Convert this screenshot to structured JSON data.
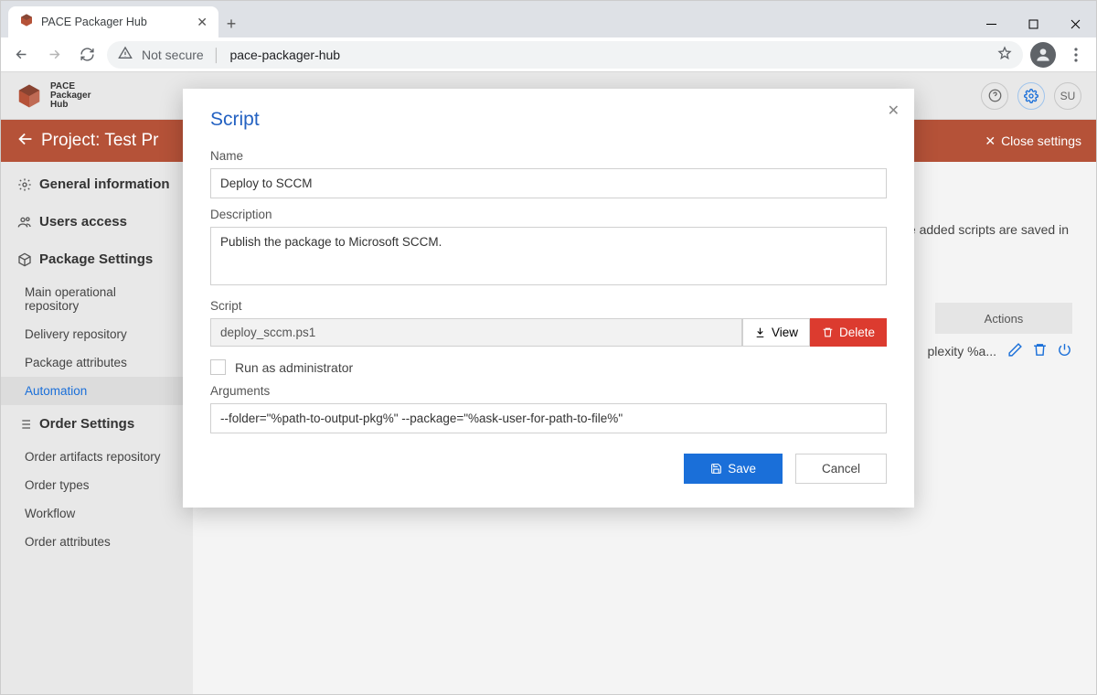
{
  "browser": {
    "tab_title": "PACE Packager Hub",
    "not_secure_label": "Not secure",
    "url": "pace-packager-hub"
  },
  "app_header": {
    "logo_line1": "PACE",
    "logo_line2": "Packager",
    "logo_line3": "Hub",
    "user_initials": "SU"
  },
  "banner": {
    "title": "Project: Test Pr",
    "close_label": "Close settings"
  },
  "sidebar": {
    "sections": [
      {
        "label": "General information",
        "icon": "gear"
      },
      {
        "label": "Users access",
        "icon": "users"
      },
      {
        "label": "Package Settings",
        "icon": "package",
        "items": [
          "Main operational repository",
          "Delivery repository",
          "Package attributes",
          "Automation"
        ],
        "active_index": 3
      },
      {
        "label": "Order Settings",
        "icon": "list",
        "items": [
          "Order artifacts repository",
          "Order types",
          "Workflow",
          "Order attributes"
        ]
      }
    ]
  },
  "main_bg": {
    "hint_fragment": "e added scripts are saved in",
    "actions_header": "Actions",
    "row_text_fragment": "plexity %a..."
  },
  "modal": {
    "title": "Script",
    "name_label": "Name",
    "name_value": "Deploy to SCCM",
    "description_label": "Description",
    "description_value": "Publish the package to Microsoft SCCM.",
    "script_label": "Script",
    "script_file": "deploy_sccm.ps1",
    "view_btn": "View",
    "delete_btn": "Delete",
    "run_as_admin_label": "Run as administrator",
    "arguments_label": "Arguments",
    "arguments_value": "--folder=\"%path-to-output-pkg%\" --package=\"%ask-user-for-path-to-file%\"",
    "save_btn": "Save",
    "cancel_btn": "Cancel"
  }
}
